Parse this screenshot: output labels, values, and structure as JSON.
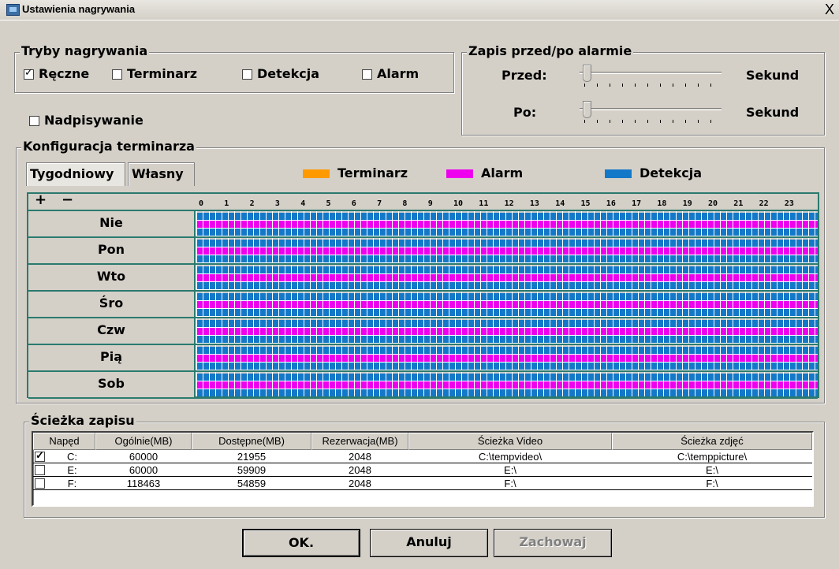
{
  "window": {
    "title": "Ustawienia nagrywania",
    "close": "X"
  },
  "modes": {
    "legend": "Tryby nagrywania",
    "items": [
      {
        "label": "Ręczne",
        "checked": true
      },
      {
        "label": "Terminarz",
        "checked": false
      },
      {
        "label": "Detekcja",
        "checked": false
      },
      {
        "label": "Alarm",
        "checked": false
      }
    ]
  },
  "overwrite": {
    "label": "Nadpisywanie",
    "checked": false
  },
  "prepost": {
    "legend": "Zapis przed/po alarmie",
    "before_label": "Przed:",
    "after_label": "Po:",
    "unit": "Sekund",
    "before_value": 0,
    "after_value": 0
  },
  "schedule": {
    "legend": "Konfiguracja terminarza",
    "tabs": [
      "Tygodniowy",
      "Własny"
    ],
    "active_tab": "Tygodniowy",
    "legend_items": [
      {
        "label": "Terminarz",
        "color": "#ff9900"
      },
      {
        "label": "Alarm",
        "color": "#ee00ee"
      },
      {
        "label": "Detekcja",
        "color": "#1478c8"
      }
    ],
    "plus": "+",
    "minus": "−",
    "hours": [
      "0",
      "1",
      "2",
      "3",
      "4",
      "5",
      "6",
      "7",
      "8",
      "9",
      "10",
      "11",
      "12",
      "13",
      "14",
      "15",
      "16",
      "17",
      "18",
      "19",
      "20",
      "21",
      "22",
      "23"
    ],
    "days": [
      "Nie",
      "Pon",
      "Wto",
      "Śro",
      "Czw",
      "Pią",
      "Sob"
    ]
  },
  "path": {
    "legend": "Ścieżka zapisu",
    "headers": [
      "Napęd",
      "Ogólnie(MB)",
      "Dostępne(MB)",
      "Rezerwacja(MB)",
      "Ścieżka Video",
      "Ścieżka zdjęć"
    ],
    "rows": [
      {
        "checked": true,
        "drive": "C:",
        "total": "60000",
        "free": "21955",
        "reserve": "2048",
        "video": "C:\\tempvideo\\",
        "picture": "C:\\temppicture\\"
      },
      {
        "checked": false,
        "drive": "E:",
        "total": "60000",
        "free": "59909",
        "reserve": "2048",
        "video": "E:\\",
        "picture": "E:\\"
      },
      {
        "checked": false,
        "drive": "F:",
        "total": "118463",
        "free": "54859",
        "reserve": "2048",
        "video": "F:\\",
        "picture": "F:\\"
      }
    ]
  },
  "buttons": {
    "ok": "OK.",
    "cancel": "Anuluj",
    "save": "Zachowaj"
  }
}
